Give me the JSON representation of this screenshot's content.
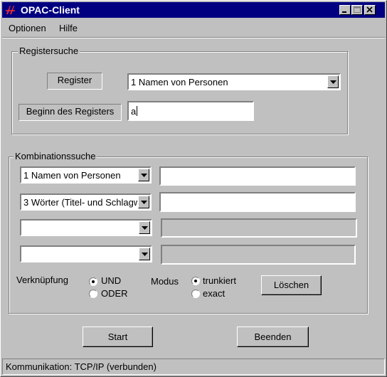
{
  "window": {
    "title": "OPAC-Client",
    "controls": {
      "minimize": "_",
      "maximize": "□",
      "close": "✕"
    }
  },
  "menu": [
    {
      "label": "Optionen"
    },
    {
      "label": "Hilfe"
    }
  ],
  "registersuche": {
    "group_title": "Registersuche",
    "register_label": "Register",
    "register_select_value": "1 Namen von Personen",
    "beginn_label": "Beginn des Registers",
    "beginn_value": "a"
  },
  "kombinationssuche": {
    "group_title": "Kombinationssuche",
    "rows": [
      {
        "select_value": "1 Namen von Personen",
        "text_value": "",
        "enabled": true
      },
      {
        "select_value": "3 Wörter (Titel- und Schlagw",
        "text_value": "",
        "enabled": true
      },
      {
        "select_value": "",
        "text_value": "",
        "enabled": false
      },
      {
        "select_value": "",
        "text_value": "",
        "enabled": false
      }
    ],
    "verknuepfung_label": "Verknüpfung",
    "verknuepfung_options": [
      "UND",
      "ODER"
    ],
    "verknuepfung_selected": "UND",
    "modus_label": "Modus",
    "modus_options": [
      "trunkiert",
      "exact"
    ],
    "modus_selected": "trunkiert",
    "loeschen_label": "Löschen"
  },
  "buttons": {
    "start": "Start",
    "beenden": "Beenden"
  },
  "status": {
    "text": "Kommunikation: TCP/IP (verbunden)"
  }
}
